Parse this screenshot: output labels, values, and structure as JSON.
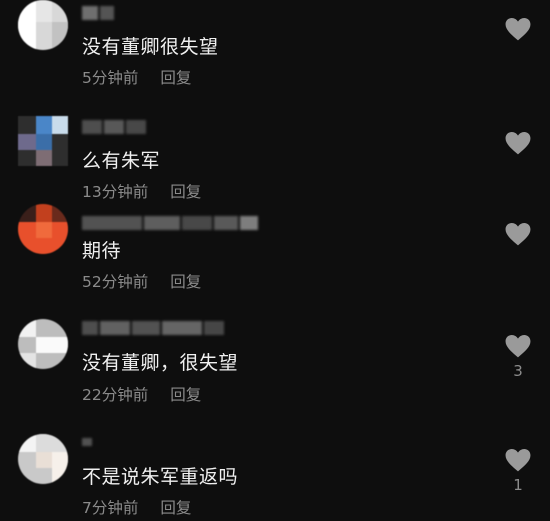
{
  "comments": [
    {
      "text": "没有董卿很失望",
      "time": "5分钟前",
      "reply": "回复",
      "likes": ""
    },
    {
      "text": "么有朱军",
      "time": "13分钟前",
      "reply": "回复",
      "likes": ""
    },
    {
      "text": "期待",
      "time": "52分钟前",
      "reply": "回复",
      "likes": ""
    },
    {
      "text": "没有董卿，很失望",
      "time": "22分钟前",
      "reply": "回复",
      "likes": "3"
    },
    {
      "text": "不是说朱军重返吗",
      "time": "7分钟前",
      "reply": "回复",
      "likes": "1"
    }
  ],
  "colors": {
    "background": "#0e0e0e",
    "text": "#f0f0f0",
    "meta": "#8b8b8b",
    "heart": "#9a9a9a"
  },
  "icons": {
    "like": "heart-icon"
  }
}
